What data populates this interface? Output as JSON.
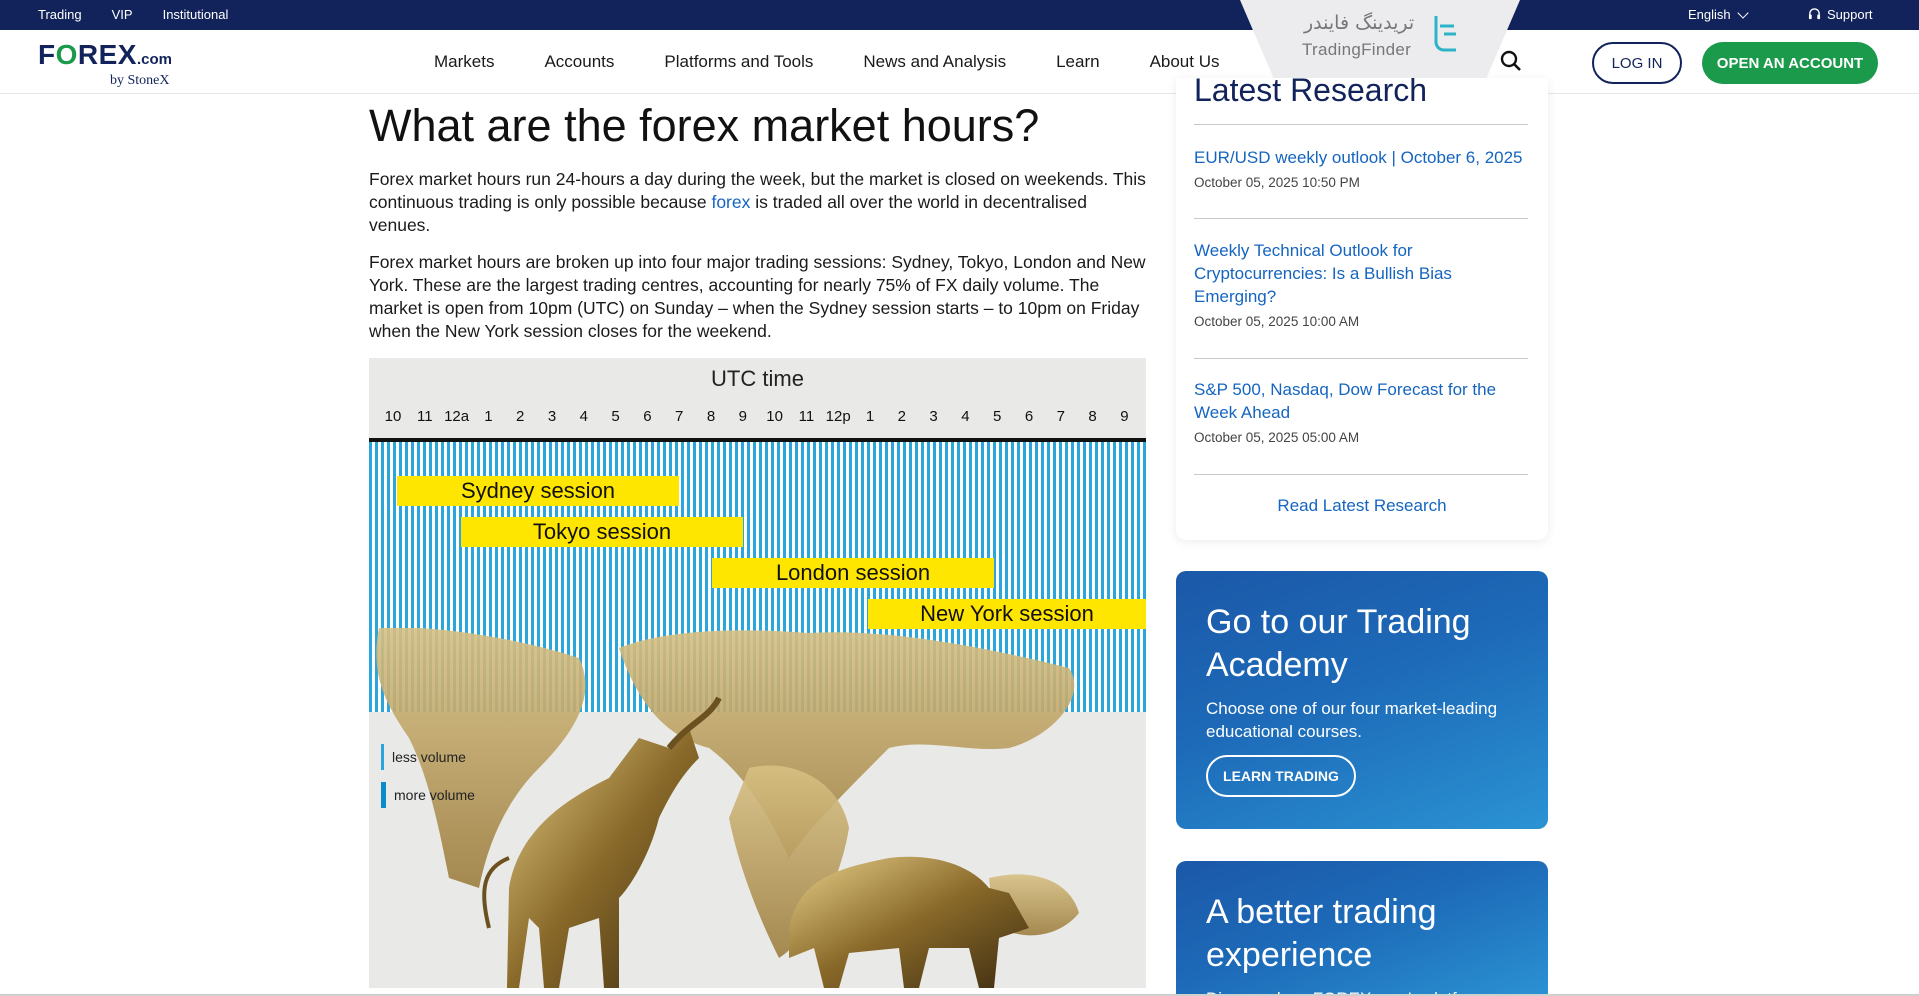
{
  "topbar": {
    "links": [
      "Trading",
      "VIP",
      "Institutional"
    ],
    "language": "English",
    "support": "Support"
  },
  "watermark": {
    "farsi": "تریدینگ فایندر",
    "english": "TradingFinder"
  },
  "brand": {
    "name_pre": "F",
    "name_o": "O",
    "name_post": "REX",
    "dotcom": ".com",
    "by": "by StoneX"
  },
  "nav": {
    "items": [
      "Markets",
      "Accounts",
      "Platforms and Tools",
      "News and Analysis",
      "Learn",
      "About Us"
    ],
    "login": "LOG IN",
    "open_account": "OPEN AN ACCOUNT"
  },
  "article": {
    "title": "What are the forex market hours?",
    "p1_before": "Forex market hours run 24-hours a day during the week, but the market is closed on weekends. This continuous trading is only possible because ",
    "p1_link": "forex",
    "p1_after": " is traded all over the world in decentralised venues.",
    "p2": "Forex market hours are broken up into four major trading sessions: Sydney, Tokyo, London and New York. These are the largest trading centres, accounting for nearly 75% of FX daily volume. The market is open from 10pm (UTC) on Sunday – when the Sydney session starts – to 10pm on Friday when the New York session closes for the weekend."
  },
  "figure": {
    "title": "UTC time",
    "hours": [
      "10",
      "11",
      "12a",
      "1",
      "2",
      "3",
      "4",
      "5",
      "6",
      "7",
      "8",
      "9",
      "10",
      "11",
      "12p",
      "1",
      "2",
      "3",
      "4",
      "5",
      "6",
      "7",
      "8",
      "9"
    ],
    "sessions": [
      "Sydney session",
      "Tokyo session",
      "London session",
      "New York session"
    ],
    "legend_less": "less volume",
    "legend_more": "more volume",
    "stripe_color": "#2aa6dc",
    "session_color": "#ffe600"
  },
  "research": {
    "title": "Latest Research",
    "items": [
      {
        "title": "EUR/USD weekly outlook | October 6, 2025",
        "date": "October 05, 2025 10:50 PM"
      },
      {
        "title": "Weekly Technical Outlook for Cryptocurrencies: Is a Bullish Bias Emerging?",
        "date": "October 05, 2025 10:00 AM"
      },
      {
        "title": "S&P 500, Nasdaq, Dow Forecast for the Week Ahead",
        "date": "October 05, 2025 05:00 AM"
      }
    ],
    "link": "Read Latest Research"
  },
  "promo_academy": {
    "title": "Go to our Trading Academy",
    "text": "Choose one of our four market-leading educational courses.",
    "button": "LEARN TRADING"
  },
  "promo_experience": {
    "title": "A better trading experience",
    "text": "Discover how FOREX.com's platforms"
  },
  "colors": {
    "navy": "#11235a",
    "green": "#1a9a4a",
    "link": "#1565c0"
  }
}
